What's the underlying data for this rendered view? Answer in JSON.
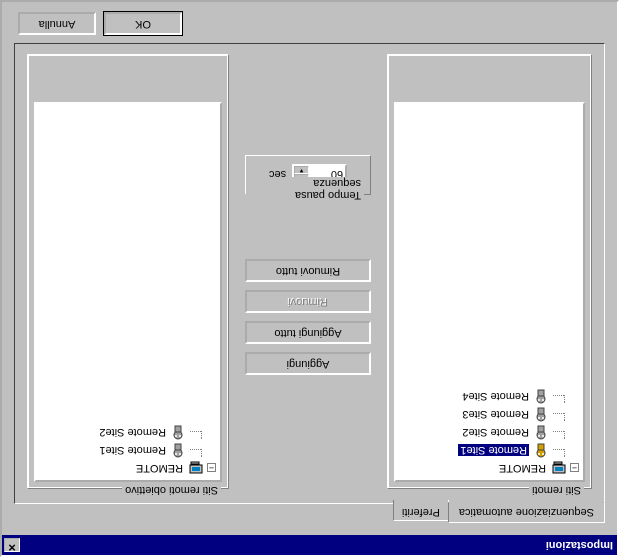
{
  "window": {
    "title": "Impostazioni"
  },
  "tabs": {
    "active": "Sequenziazione automatica",
    "inactive": "Preferiti"
  },
  "trees": {
    "left": {
      "legend": "Siti remoti",
      "root": "REMOTE",
      "items": [
        {
          "label": "Remote Site1",
          "variant": "gold",
          "selected": true
        },
        {
          "label": "Remote Site2",
          "variant": "grey",
          "selected": false
        },
        {
          "label": "Remote Site3",
          "variant": "grey",
          "selected": false
        },
        {
          "label": "Remote Site4",
          "variant": "grey",
          "selected": false
        }
      ]
    },
    "right": {
      "legend": "Siti remoti obiettivo",
      "root": "REMOTE",
      "items": [
        {
          "label": "Remote Site1",
          "variant": "grey",
          "selected": false
        },
        {
          "label": "Remote Site2",
          "variant": "grey",
          "selected": false
        }
      ]
    }
  },
  "buttons": {
    "add": "Aggiungi",
    "add_all": "Aggiungi tutto",
    "remove": "Rimuovi",
    "remove_all": "Rimuovi tutto"
  },
  "pause": {
    "legend": "Tempo pausa sequenza",
    "value": "60",
    "unit": "sec"
  },
  "footer": {
    "ok": "OK",
    "cancel": "Annulla"
  },
  "icons": {
    "minus": "−",
    "close": "✕",
    "up": "▲",
    "down": "▼"
  }
}
